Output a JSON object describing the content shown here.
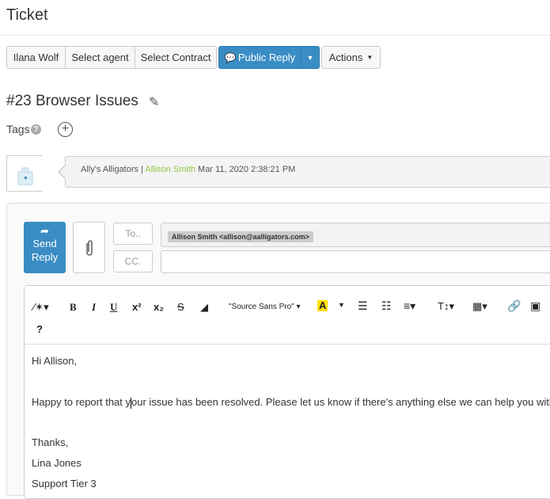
{
  "page": {
    "title": "Ticket"
  },
  "toolbar": {
    "assignee": "Ilana Wolf",
    "select_agent": "Select agent",
    "select_contract": "Select Contract",
    "public_reply": "Public Reply",
    "actions": "Actions"
  },
  "ticket": {
    "title": "#23 Browser Issues",
    "tags_label": "Tags",
    "tags_help": "?"
  },
  "message": {
    "company": "Ally's Alligators",
    "separator": " | ",
    "author": "Allison Smith",
    "date": "Mar 11, 2020 2:38:21 PM",
    "author_color": "#8dc63f"
  },
  "reply": {
    "send_label_1": "Send",
    "send_label_2": "Reply",
    "to_label": "To..",
    "cc_label": "CC.",
    "to_recipient": "Allison Smith <allison@aalligators.com>"
  },
  "editor": {
    "font_name": "\"Source Sans Pro\"",
    "help": "?",
    "body": {
      "greeting": "Hi Allison,",
      "line1_a": "Happy to report that y",
      "line1_b": "our issue has been resolved. Please let us know if there's anything else we can help you with.",
      "thanks": "Thanks,",
      "name": "Lina Jones",
      "role": "Support Tier 3"
    }
  },
  "colors": {
    "primary": "#3a8dc4",
    "highlight": "#ffe000"
  }
}
